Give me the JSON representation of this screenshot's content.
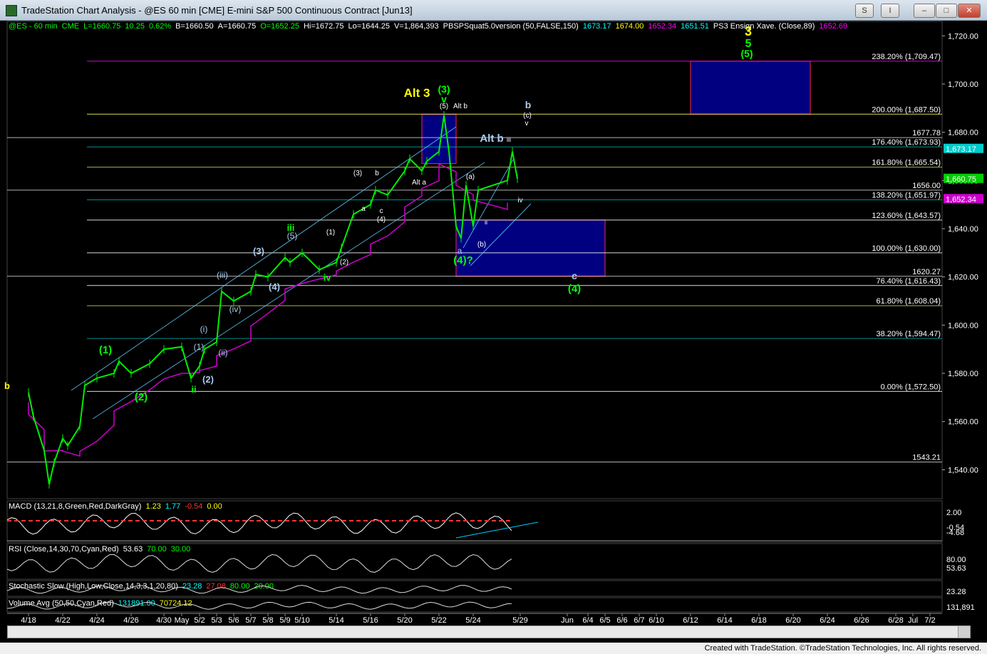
{
  "window": {
    "title": "TradeStation Chart Analysis - @ES 60 min [CME] E-mini S&P 500 Continuous Contract [Jun13]",
    "buttons": [
      "S",
      "I",
      "–",
      "□",
      "✕"
    ],
    "footer": "Created with TradeStation. ©TradeStation Technologies, Inc. All rights reserved."
  },
  "header_line": [
    {
      "text": "@ES - 60 min",
      "color": "#00ff00"
    },
    {
      "text": "CME",
      "color": "#00ff00"
    },
    {
      "text": "L=1660.75",
      "color": "#00ff00"
    },
    {
      "text": "10.25",
      "color": "#00ff00"
    },
    {
      "text": "0.62%",
      "color": "#00ff00"
    },
    {
      "text": "B=1660.50",
      "color": "#ffffff"
    },
    {
      "text": "A=1660.75",
      "color": "#ffffff"
    },
    {
      "text": "O=1652.25",
      "color": "#00ff00"
    },
    {
      "text": "Hi=1672.75",
      "color": "#ffffff"
    },
    {
      "text": "Lo=1644.25",
      "color": "#ffffff"
    },
    {
      "text": "V=1,864,393",
      "color": "#ffffff"
    },
    {
      "text": "PBSPSquat5.0version (50,FALSE,150)",
      "color": "#ffffff"
    },
    {
      "text": "1673.17",
      "color": "#00ffff"
    },
    {
      "text": "1674.00",
      "color": "#ffff00"
    },
    {
      "text": "1652.34",
      "color": "#ff00ff"
    },
    {
      "text": "1651.51",
      "color": "#00ffff"
    },
    {
      "text": "PS3 Ensign Xave. (Close,89)",
      "color": "#ffffff"
    },
    {
      "text": "1652.69",
      "color": "#ff00ff"
    }
  ],
  "chart_data": {
    "type": "line",
    "title": "@ES 60 min [CME] E-mini S&P 500 Continuous Contract [Jun13]",
    "ylim": [
      1528,
      1726
    ],
    "y_ticks": [
      1540,
      1560,
      1580,
      1600,
      1620,
      1640,
      1660,
      1680,
      1700,
      1720
    ],
    "y_tick_labels": [
      "1,540.00",
      "1,560.00",
      "1,580.00",
      "1,600.00",
      "1,620.00",
      "1,640.00",
      "1,660.00",
      "1,680.00",
      "1,700.00",
      "1,720.00"
    ],
    "x_labels": [
      "4/18",
      "4/22",
      "4/24",
      "4/26",
      "4/30",
      "May",
      "5/2",
      "5/3",
      "5/6",
      "5/7",
      "5/8",
      "5/9",
      "5/10",
      "5/14",
      "5/16",
      "5/20",
      "5/22",
      "5/24",
      "5/29",
      "Jun",
      "6/4",
      "6/5",
      "6/6",
      "6/7",
      "6/10",
      "6/12",
      "6/14",
      "6/18",
      "6/20",
      "6/24",
      "6/26",
      "6/28",
      "Jul",
      "7/2"
    ],
    "price_series": [
      [
        "4/18",
        1572
      ],
      [
        "4/18",
        1562
      ],
      [
        "4/19",
        1548
      ],
      [
        "4/19",
        1534
      ],
      [
        "4/19",
        1543
      ],
      [
        "4/22",
        1553
      ],
      [
        "4/22",
        1550
      ],
      [
        "4/23",
        1558
      ],
      [
        "4/23",
        1575
      ],
      [
        "4/24",
        1578
      ],
      [
        "4/25",
        1580
      ],
      [
        "4/25",
        1585
      ],
      [
        "4/26",
        1580
      ],
      [
        "4/29",
        1584
      ],
      [
        "4/30",
        1590
      ],
      [
        "May",
        1591
      ],
      [
        "5/1",
        1578
      ],
      [
        "5/2",
        1583
      ],
      [
        "5/2",
        1590
      ],
      [
        "5/3",
        1593
      ],
      [
        "5/3",
        1614
      ],
      [
        "5/6",
        1610
      ],
      [
        "5/7",
        1614
      ],
      [
        "5/7",
        1621
      ],
      [
        "5/8",
        1620
      ],
      [
        "5/9",
        1628
      ],
      [
        "5/9",
        1626
      ],
      [
        "5/10",
        1630
      ],
      [
        "5/13",
        1623
      ],
      [
        "5/14",
        1626
      ],
      [
        "5/14",
        1632
      ],
      [
        "5/15",
        1646
      ],
      [
        "5/16",
        1650
      ],
      [
        "5/16",
        1656
      ],
      [
        "5/17",
        1654
      ],
      [
        "5/20",
        1664
      ],
      [
        "5/20",
        1669
      ],
      [
        "5/21",
        1664
      ],
      [
        "5/21",
        1668
      ],
      [
        "5/22",
        1672
      ],
      [
        "5/22",
        1687
      ],
      [
        "5/22",
        1672
      ],
      [
        "5/23",
        1641
      ],
      [
        "5/23",
        1636
      ],
      [
        "5/23",
        1658
      ],
      [
        "5/24",
        1641
      ],
      [
        "5/24",
        1656
      ],
      [
        "5/28",
        1660
      ],
      [
        "5/28",
        1672
      ],
      [
        "5/28",
        1660.75
      ]
    ],
    "fib_levels": [
      {
        "label": "238.20% (1,709.47)",
        "value": 1709.47,
        "color": "#ff00ff"
      },
      {
        "label": "200.00% (1,687.50)",
        "value": 1687.5,
        "color": "#ffff66"
      },
      {
        "label": "176.40% (1,673.93)",
        "value": 1673.93,
        "color": "#00aaaa"
      },
      {
        "label": "161.80% (1,665.54)",
        "value": 1665.54,
        "color": "#cccc66"
      },
      {
        "label": "138.20% (1,651.97)",
        "value": 1651.97,
        "color": "#00aaaa"
      },
      {
        "label": "123.60% (1,643.57)",
        "value": 1643.57,
        "color": "#ffffff"
      },
      {
        "label": "100.00% (1,630.00)",
        "value": 1630.0,
        "color": "#ffffff"
      },
      {
        "label": "76.40% (1,616.43)",
        "value": 1616.43,
        "color": "#ffffff"
      },
      {
        "label": "61.80% (1,608.04)",
        "value": 1608.04,
        "color": "#cccc66"
      },
      {
        "label": "38.20% (1,594.47)",
        "value": 1594.47,
        "color": "#00aaaa"
      },
      {
        "label": "0.00% (1,572.50)",
        "value": 1572.5,
        "color": "#ffffff"
      }
    ],
    "horizontal_levels": [
      {
        "label": "1677.78",
        "value": 1677.78
      },
      {
        "label": "1656.00",
        "value": 1656.0
      },
      {
        "label": "1620.27",
        "value": 1620.27
      },
      {
        "label": "1543.21",
        "value": 1543.21
      }
    ],
    "axis_badges": [
      {
        "label": "1,673.17",
        "value": 1673.17,
        "bg": "#00cccc",
        "fg": "#000000"
      },
      {
        "label": "1,660.75",
        "value": 1660.75,
        "bg": "#00cc00",
        "fg": "#000000"
      },
      {
        "label": "1,652.34",
        "value": 1652.34,
        "bg": "#cc00cc",
        "fg": "#ffffff"
      }
    ],
    "target_boxes": [
      {
        "label": "target-box-wave-5",
        "x_from": "6/12",
        "x_to": "6/21",
        "y_low": 1687.5,
        "y_high": 1709.47
      },
      {
        "label": "target-box-alt-3",
        "x_from": "5/21",
        "x_to": "5/23",
        "y_low": 1667,
        "y_high": 1687.5
      },
      {
        "label": "target-box-wave-4",
        "x_from": "5/23",
        "x_to": "6/5",
        "y_low": 1620.27,
        "y_high": 1643.57
      }
    ],
    "wave_labels": [
      {
        "text": "3",
        "color": "#ffff00"
      },
      {
        "text": "5",
        "color": "#00ff00"
      },
      {
        "text": "(5)",
        "color": "#00ff00"
      },
      {
        "text": "Alt 3",
        "color": "#ffff00"
      },
      {
        "text": "(3)",
        "color": "#00ff00"
      },
      {
        "text": "v",
        "color": "#00ff00"
      },
      {
        "text": "(5)",
        "color": "#ffffff"
      },
      {
        "text": "Alt b",
        "color": "#ffffff"
      },
      {
        "text": "b",
        "color": "#aaccee"
      },
      {
        "text": "(c)",
        "color": "#ffffff"
      },
      {
        "text": "v",
        "color": "#ffffff"
      },
      {
        "text": "Alt b",
        "color": "#aaccee"
      },
      {
        "text": "iii",
        "color": "#ffffff"
      },
      {
        "text": "Alt a",
        "color": "#ffffff"
      },
      {
        "text": "(a)",
        "color": "#ffffff"
      },
      {
        "text": "iv",
        "color": "#ffffff"
      },
      {
        "text": "ii",
        "color": "#ffffff"
      },
      {
        "text": "(b)",
        "color": "#ffffff"
      },
      {
        "text": "a",
        "color": "#aaccee"
      },
      {
        "text": "(4)?",
        "color": "#00ff00"
      },
      {
        "text": "c",
        "color": "#aaccee"
      },
      {
        "text": "(4)",
        "color": "#00ff00"
      },
      {
        "text": "(3)",
        "color": "#ffffff"
      },
      {
        "text": "b",
        "color": "#ffffff"
      },
      {
        "text": "a",
        "color": "#ffffff"
      },
      {
        "text": "c",
        "color": "#ffffff"
      },
      {
        "text": "(4)",
        "color": "#ffffff"
      },
      {
        "text": "(1)",
        "color": "#ffffff"
      },
      {
        "text": "(2)",
        "color": "#ffffff"
      },
      {
        "text": "iii",
        "color": "#00ff00"
      },
      {
        "text": "(5)",
        "color": "#aaccee"
      },
      {
        "text": "(3)",
        "color": "#aaccee"
      },
      {
        "text": "(4)",
        "color": "#aaccee"
      },
      {
        "text": "iv",
        "color": "#00ff00"
      },
      {
        "text": "(iii)",
        "color": "#aaccee"
      },
      {
        "text": "(iv)",
        "color": "#aaccee"
      },
      {
        "text": "(i)",
        "color": "#aaccee"
      },
      {
        "text": "(ii)",
        "color": "#aaccee"
      },
      {
        "text": "(1)",
        "color": "#aaccee"
      },
      {
        "text": "(2)",
        "color": "#aaccee"
      },
      {
        "text": "ii",
        "color": "#00ff00"
      },
      {
        "text": "(1)",
        "color": "#00ff00"
      },
      {
        "text": "(2)",
        "color": "#00ff00"
      },
      {
        "text": "b",
        "color": "#ffff00"
      }
    ]
  },
  "indicators": {
    "macd": {
      "name": "MACD (13,21,8,Green,Red,DarkGray)",
      "values": [
        {
          "text": "1.23",
          "color": "#ffff00"
        },
        {
          "text": "1.77",
          "color": "#00ffff"
        },
        {
          "text": "-0.54",
          "color": "#ff3333"
        },
        {
          "text": "0.00",
          "color": "#ffff00"
        }
      ],
      "ticks": [
        "2.00",
        "-0.54",
        "-4.68"
      ]
    },
    "rsi": {
      "name": "RSI (Close,14,30,70,Cyan,Red)",
      "values": [
        {
          "text": "53.63",
          "color": "#ffffff"
        },
        {
          "text": "70.00",
          "color": "#00ff00"
        },
        {
          "text": "30.00",
          "color": "#00ff00"
        }
      ],
      "ticks": [
        "80.00",
        "53.63"
      ]
    },
    "stoch": {
      "name": "Stochastic Slow (High,Low,Close,14,3,3,1,20,80)",
      "values": [
        {
          "text": "23.28",
          "color": "#00ffff"
        },
        {
          "text": "27.08",
          "color": "#ff3333"
        },
        {
          "text": "80.00",
          "color": "#00ff00"
        },
        {
          "text": "20.00",
          "color": "#00ff00"
        }
      ],
      "ticks": [
        "23.28"
      ]
    },
    "volume": {
      "name": "Volume Avg (50,50,Cyan,Red)",
      "values": [
        {
          "text": "131891.00",
          "color": "#00ffff"
        },
        {
          "text": "70724.12",
          "color": "#ffff00"
        }
      ],
      "ticks": [
        "131,891"
      ]
    }
  }
}
